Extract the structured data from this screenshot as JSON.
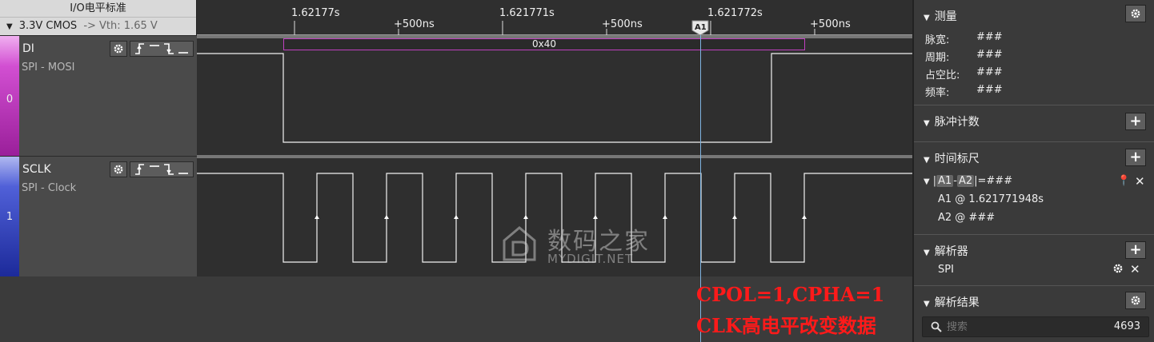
{
  "io_header": {
    "title": "I/O电平标准",
    "standard": "3.3V CMOS",
    "vth": "-> Vth: 1.65 V"
  },
  "ruler": {
    "major_labels": [
      "1.62177s",
      "1.621771s",
      "1.621772s"
    ],
    "minor_labels": [
      "+500ns",
      "+500ns",
      "+500ns"
    ],
    "cursor_label": "A1"
  },
  "channels": [
    {
      "index": "0",
      "name": "DI",
      "subtitle": "SPI - MOSI",
      "color": "#c43bc4"
    },
    {
      "index": "1",
      "name": "SCLK",
      "subtitle": "SPI - Clock",
      "color": "#3b4fc4"
    }
  ],
  "decode": {
    "value": "0x40"
  },
  "watermark": {
    "cn": "数码之家",
    "en": "MYDIGIT.NET"
  },
  "annotation": {
    "line1": "CPOL=1,CPHA=1",
    "line2": "CLK高电平改变数据"
  },
  "right_panel": {
    "measure": {
      "title": "测量",
      "rows": [
        {
          "label": "脉宽:",
          "value": "###"
        },
        {
          "label": "周期:",
          "value": "###"
        },
        {
          "label": "占空比:",
          "value": "###"
        },
        {
          "label": "频率:",
          "value": "###"
        }
      ]
    },
    "pulse_count": {
      "title": "脉冲计数"
    },
    "timing": {
      "title": "时间标尺",
      "bar_open": "|",
      "a1": "A1",
      "dash": "-",
      "a2": "A2",
      "bar_close": "|=###",
      "a1_line": "A1 @ 1.621771948s",
      "a2_line": "A2 @ ###"
    },
    "analyzer": {
      "title": "解析器",
      "item": "SPI"
    },
    "results": {
      "title": "解析结果",
      "search_placeholder": "搜索",
      "count": "4693"
    }
  }
}
